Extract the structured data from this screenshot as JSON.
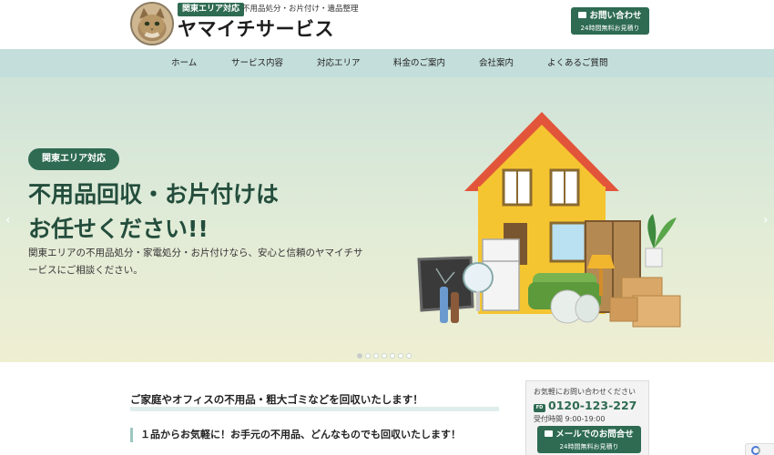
{
  "header": {
    "badge": "関東エリア対応",
    "tagline": "不用品処分・お片付け・遺品整理",
    "site_name": "ヤマイチサービス",
    "contact_button": {
      "label": "お問い合わせ",
      "sub": "24時間無料お見積り"
    }
  },
  "nav": {
    "items": [
      {
        "label": "ホーム"
      },
      {
        "label": "サービス内容"
      },
      {
        "label": "対応エリア"
      },
      {
        "label": "料金のご案内"
      },
      {
        "label": "会社案内"
      },
      {
        "label": "よくあるご質問"
      }
    ]
  },
  "hero": {
    "badge": "関東エリア対応",
    "title_line1": "不用品回収・お片付けは",
    "title_line2": "お任せください!!",
    "description": "関東エリアの不用品処分・家電処分・お片付けなら、安心と信頼のヤマイチサービスにご相談ください。",
    "prev_arrow": "‹",
    "next_arrow": "›",
    "slide_count": 7,
    "active_slide": 1
  },
  "main": {
    "section_title": "ご家庭やオフィスの不用品・粗大ゴミなどを回収いたします！",
    "sub_title": "１品からお気軽に！お手元の不用品、どんなものでも回収いたします！"
  },
  "sidebar": {
    "note": "お気軽にお問い合わせください",
    "phone_icon": "FD",
    "phone": "0120-123-227",
    "hours": "受付時間 9:00-19:00",
    "mail_button": {
      "label": "メールでのお問合せ",
      "sub": "24時間無料お見積り"
    }
  },
  "colors": {
    "brand_green": "#2e6b52",
    "nav_bg": "#c3dedb",
    "roof": "#e2553a",
    "house": "#f5c531"
  },
  "icons": {
    "mail": "mail-icon",
    "phone": "freedial-icon",
    "logo": "cat-logo-icon",
    "recaptcha": "recaptcha-icon"
  }
}
